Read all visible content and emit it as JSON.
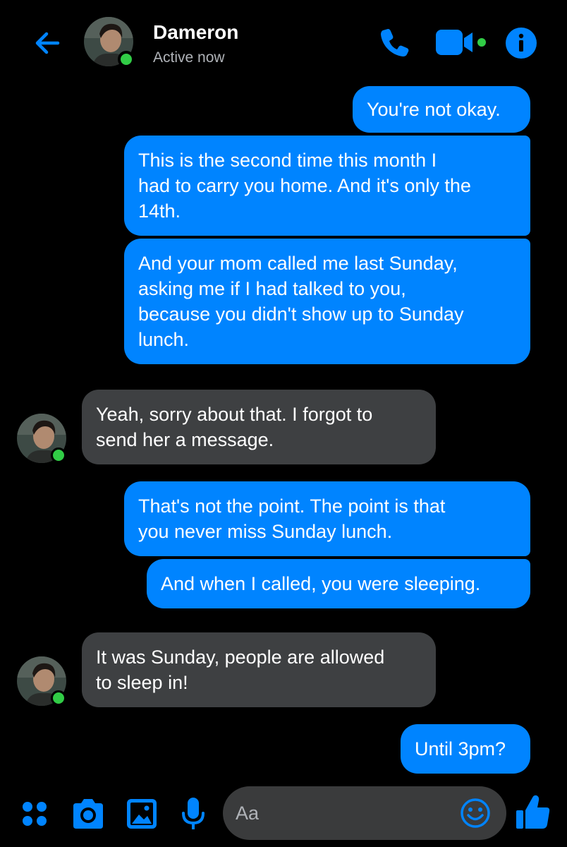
{
  "colors": {
    "accent": "#0084ff",
    "background": "#000000",
    "incoming_bubble": "#3e4042",
    "online": "#31cc46",
    "composer_bg": "#3a3b3c"
  },
  "header": {
    "back_icon": "arrow-left-icon",
    "contact_name": "Dameron",
    "status": "Active now",
    "actions": [
      "phone-icon",
      "video-camera-icon",
      "info-icon"
    ]
  },
  "messages": [
    {
      "direction": "outgoing",
      "text": "You're not okay."
    },
    {
      "direction": "outgoing",
      "lines": [
        "This is the second time this month I",
        "had to carry you home. And it's only the",
        "14th."
      ]
    },
    {
      "direction": "outgoing",
      "lines": [
        "And your mom called me last Sunday,",
        "asking me if I had talked to you,",
        "because you didn't show up to Sunday",
        "lunch."
      ]
    },
    {
      "direction": "incoming",
      "lines": [
        "Yeah, sorry about that. I forgot to",
        "send her a message."
      ]
    },
    {
      "direction": "outgoing",
      "lines": [
        "That's not the point. The point is that",
        "you never miss Sunday lunch."
      ]
    },
    {
      "direction": "outgoing",
      "text": "And when I called, you were sleeping."
    },
    {
      "direction": "incoming",
      "lines": [
        "It was Sunday, people are allowed",
        "to sleep in!"
      ]
    },
    {
      "direction": "outgoing",
      "text": "Until 3pm?"
    }
  ],
  "composer": {
    "placeholder": "Aa",
    "buttons": [
      "apps-icon",
      "camera-icon",
      "gallery-icon",
      "microphone-icon"
    ],
    "emoji_icon": "smiley-icon",
    "like_icon": "thumbs-up-icon"
  }
}
